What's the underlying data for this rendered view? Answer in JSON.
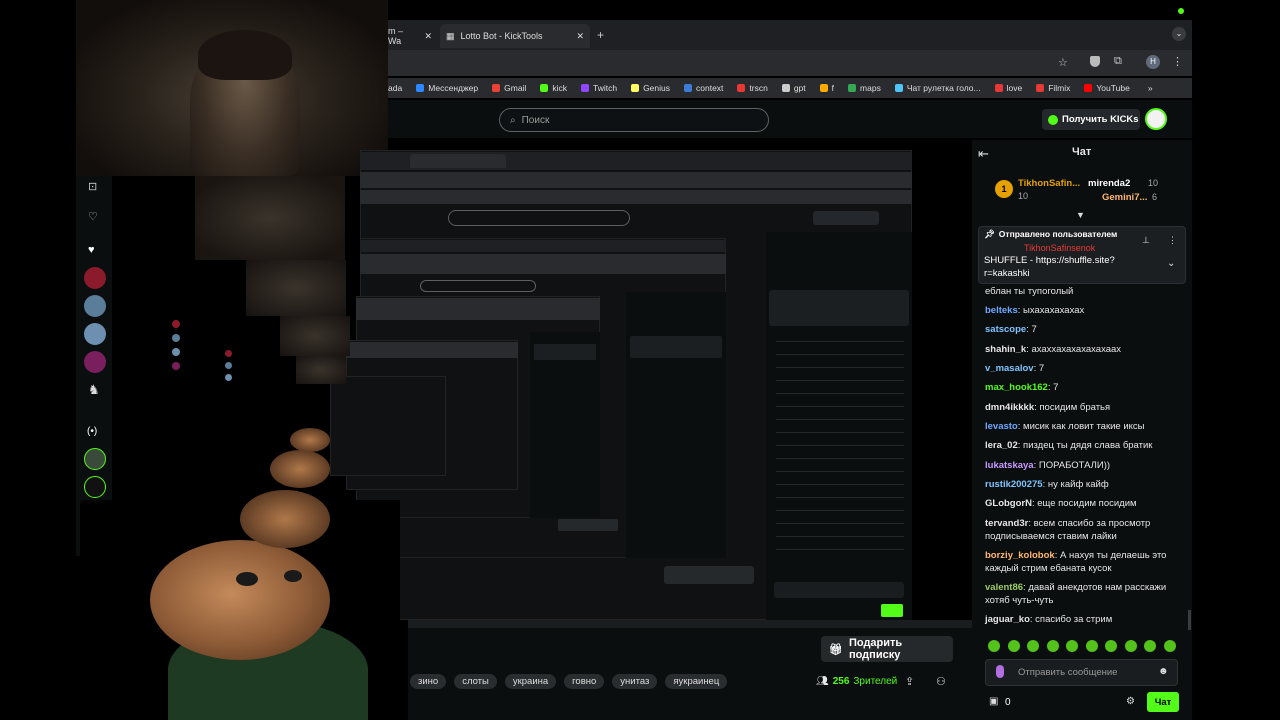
{
  "browser": {
    "tabs": [
      {
        "label": "m – Wa",
        "active": false
      },
      {
        "label": "Lotto Bot - KickTools",
        "active": true
      }
    ],
    "bookmarks": [
      {
        "label": "ada",
        "color": "#888888"
      },
      {
        "label": "Мессенджер",
        "color": "#2d88ff"
      },
      {
        "label": "Gmail",
        "color": "#ea4335"
      },
      {
        "label": "kick",
        "color": "#53fc18"
      },
      {
        "label": "Twitch",
        "color": "#9146ff"
      },
      {
        "label": "Genius",
        "color": "#ffff64"
      },
      {
        "label": "context",
        "color": "#3a7bd5"
      },
      {
        "label": "trscn",
        "color": "#e53935"
      },
      {
        "label": "gpt",
        "color": "#cccccc"
      },
      {
        "label": "f",
        "color": "#ffaa00"
      },
      {
        "label": "maps",
        "color": "#34a853"
      },
      {
        "label": "Чат рулетка голо...",
        "color": "#4fc3f7"
      },
      {
        "label": "love",
        "color": "#e53935"
      },
      {
        "label": "Filmix",
        "color": "#e53935"
      },
      {
        "label": "YouTube",
        "color": "#ff0000"
      }
    ]
  },
  "kick": {
    "search_placeholder": "Поиск",
    "get_kicks_label": "Получить KICKs",
    "gift_sub_label": "Подарить подписку",
    "viewers_count": "256",
    "viewers_label": "Зрителей",
    "tags": [
      "зино",
      "слоты",
      "украина",
      "говно",
      "унитаз",
      "яукраинец"
    ]
  },
  "chat": {
    "title": "Чат",
    "leaderboard": [
      {
        "name": "TikhonSafin...",
        "count": "10"
      },
      {
        "name": "mirenda2",
        "count": "10"
      },
      {
        "name": "Gemini7...",
        "count": "6"
      }
    ],
    "pinned_label": "Отправлено пользователем",
    "pinned_user": "TikhonSafinsenok",
    "pinned_text": "SHUFFLE - https://shuffle.site?r=kakashki",
    "pinned_text_line1": "SHUFFLE - https://shuffle.site?",
    "pinned_text_line2": "r=kakashki",
    "messages": [
      {
        "user": "",
        "text": "еблан ты тупоголый",
        "color": "#e6e6e6"
      },
      {
        "user": "belteks",
        "text": "ыхахахахахах",
        "color": "#6fa8ff"
      },
      {
        "user": "satscope",
        "text": "7",
        "color": "#7ec4ff"
      },
      {
        "user": "shahin_k",
        "text": "ахаххахахахахахааx",
        "color": "#e6e6e6"
      },
      {
        "user": "v_masalov",
        "text": "7",
        "color": "#7ec4ff"
      },
      {
        "user": "max_hook162",
        "text": "7",
        "color": "#53fc18"
      },
      {
        "user": "dmn4ikkkk",
        "text": "посидим братья",
        "color": "#e6e6e6"
      },
      {
        "user": "levasto",
        "text": "мисик как ловит такие иксы",
        "color": "#6fa8ff"
      },
      {
        "user": "lera_02",
        "text": "пиздец ты дядя слава братик",
        "color": "#e6e6e6"
      },
      {
        "user": "lukatskaya",
        "text": "ПОРАБОТАЛИ))",
        "color": "#c89bff"
      },
      {
        "user": "rustik200275",
        "text": "ну кайф кайф",
        "color": "#7ec4ff"
      },
      {
        "user": "GLobgorN",
        "text": "еще посидим посидим",
        "color": "#e6e6e6"
      },
      {
        "user": "tervand3r",
        "text": "всем спасибо за просмотр",
        "color": "#e6e6e6"
      },
      {
        "user": "",
        "text": "подписываемся ставим лайки",
        "color": "#e6e6e6"
      },
      {
        "user": "borziy_kolobok",
        "text": "А нахуя ты делаешь это",
        "color": "#ffb86b"
      },
      {
        "user": "",
        "text": "каждый стрим ебаната кусок",
        "color": "#e6e6e6"
      },
      {
        "user": "valent86",
        "text": "давай анекдотов нам расскажи",
        "color": "#9ccc65"
      },
      {
        "user": "",
        "text": "хотяб чуть-чуть",
        "color": "#e6e6e6"
      },
      {
        "user": "jaguar_ko",
        "text": "спасибо за стрим",
        "color": "#e6e6e6"
      }
    ],
    "input_placeholder": "Отправить сообщение",
    "points": "0",
    "send_label": "Чат"
  },
  "colors": {
    "accent": "#53fc18",
    "bg": "#0b0e0f"
  }
}
